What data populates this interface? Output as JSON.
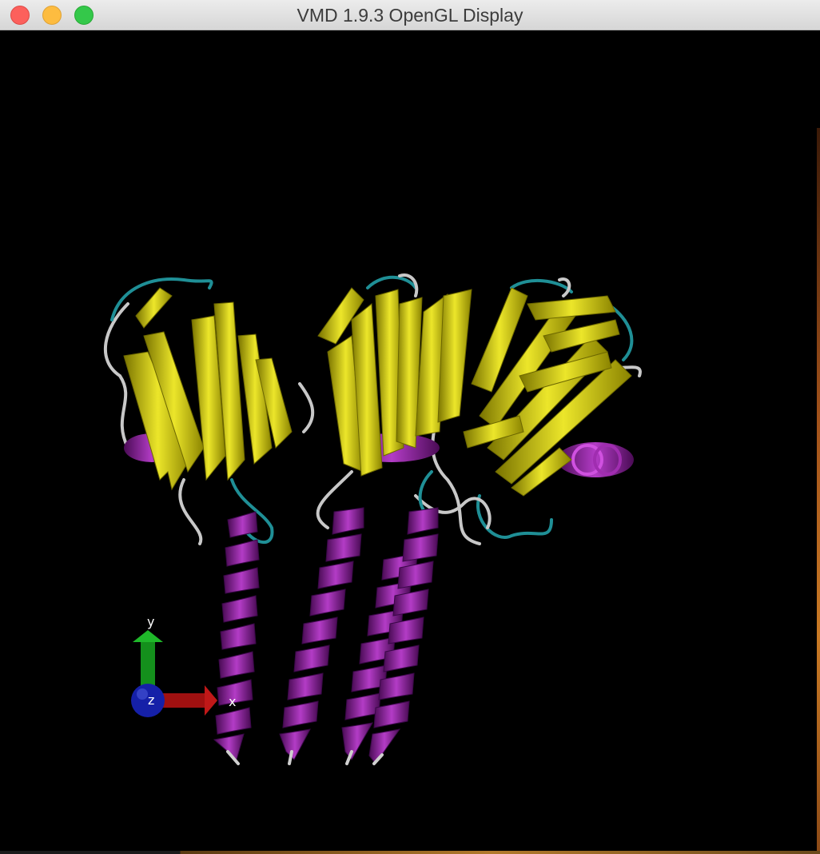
{
  "window": {
    "title": "VMD 1.9.3 OpenGL Display",
    "buttons": [
      "close",
      "minimize",
      "zoom"
    ]
  },
  "scene": {
    "background_color": "#000000",
    "representation_colors": {
      "beta_sheet": "#d4d000",
      "alpha_helix": "#8a1a9a",
      "turn": "#1f8f96",
      "coil": "#c8c8c8"
    }
  },
  "axes": {
    "x_label": "x",
    "y_label": "y",
    "z_label": "z",
    "x_color": "#b01010",
    "y_color": "#14901c",
    "z_color": "#1520a8"
  }
}
